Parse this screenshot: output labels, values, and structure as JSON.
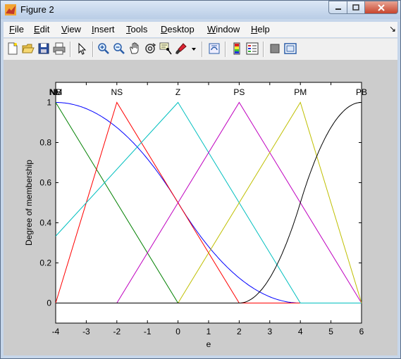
{
  "window": {
    "title": "Figure 2"
  },
  "menu": [
    {
      "pre": "",
      "u": "F",
      "post": "ile"
    },
    {
      "pre": "",
      "u": "E",
      "post": "dit"
    },
    {
      "pre": "",
      "u": "V",
      "post": "iew"
    },
    {
      "pre": "",
      "u": "I",
      "post": "nsert"
    },
    {
      "pre": "",
      "u": "T",
      "post": "ools"
    },
    {
      "pre": "",
      "u": "D",
      "post": "esktop"
    },
    {
      "pre": "",
      "u": "W",
      "post": "indow"
    },
    {
      "pre": "",
      "u": "H",
      "post": "elp"
    }
  ],
  "toolbar_icons": [
    "new-figure-icon",
    "open-file-icon",
    "save-icon",
    "print-icon",
    "pointer-icon",
    "zoom-in-icon",
    "zoom-out-icon",
    "pan-icon",
    "rotate-3d-icon",
    "data-cursor-icon",
    "brush-icon",
    "brush-dropdown-icon",
    "link-plot-icon",
    "colorbar-icon",
    "legend-icon",
    "hide-plot-tools-icon",
    "show-plot-tools-icon"
  ],
  "chart_data": {
    "type": "line",
    "xlabel": "e",
    "ylabel": "Degree of membership",
    "xlim": [
      -4,
      6
    ],
    "ylim": [
      -0.1,
      1.1
    ],
    "xticks": [
      -4,
      -3,
      -2,
      -1,
      0,
      1,
      2,
      3,
      4,
      5,
      6
    ],
    "yticks": [
      0,
      0.2,
      0.4,
      0.6,
      0.8,
      1
    ],
    "series": [
      {
        "name": "NB",
        "color": "#0000ff",
        "shape": "zmf",
        "params": [
          -4,
          4
        ]
      },
      {
        "name": "NM",
        "color": "#008000",
        "x": [
          -4,
          0
        ],
        "y": [
          1,
          0
        ]
      },
      {
        "name": "NS",
        "color": "#ff0000",
        "x": [
          -4,
          -2,
          2
        ],
        "y": [
          0,
          1,
          0
        ]
      },
      {
        "name": "Z",
        "color": "#00bfbf",
        "x": [
          -6,
          0,
          4
        ],
        "y": [
          0,
          1,
          0
        ]
      },
      {
        "name": "PS",
        "color": "#bf00bf",
        "x": [
          -2,
          2,
          6
        ],
        "y": [
          0,
          1,
          0
        ]
      },
      {
        "name": "PM",
        "color": "#bfbf00",
        "x": [
          0,
          4,
          6
        ],
        "y": [
          0,
          1,
          0
        ]
      },
      {
        "name": "PB",
        "color": "#000000",
        "shape": "smf",
        "params": [
          2,
          6
        ]
      }
    ],
    "top_labels": [
      {
        "text": "NB",
        "x": -4
      },
      {
        "text": "NM",
        "x": -4
      },
      {
        "text": "NS",
        "x": -2
      },
      {
        "text": "Z",
        "x": 0
      },
      {
        "text": "PS",
        "x": 2
      },
      {
        "text": "PM",
        "x": 4
      },
      {
        "text": "PB",
        "x": 6
      }
    ]
  }
}
